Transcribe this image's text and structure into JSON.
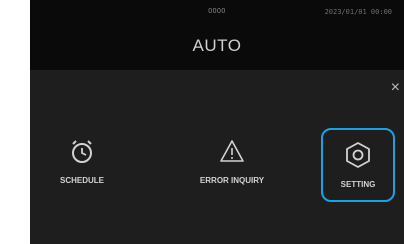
{
  "header": {
    "small_label": "0000",
    "datetime": "2023/01/01 00:00",
    "mode": "AUTO"
  },
  "overlay": {
    "close_glyph": "×"
  },
  "menu": {
    "items": [
      {
        "label": "SCHEDULE",
        "icon": "alarm-clock-icon"
      },
      {
        "label": "ERROR INQUIRY",
        "icon": "warning-triangle-icon"
      },
      {
        "label": "SETTING",
        "icon": "hexagon-gear-icon",
        "selected": true
      }
    ]
  },
  "colors": {
    "background": "#111111",
    "panel": "#1e1e1e",
    "text": "#d2d2d2",
    "highlight": "#1aa2e3"
  }
}
